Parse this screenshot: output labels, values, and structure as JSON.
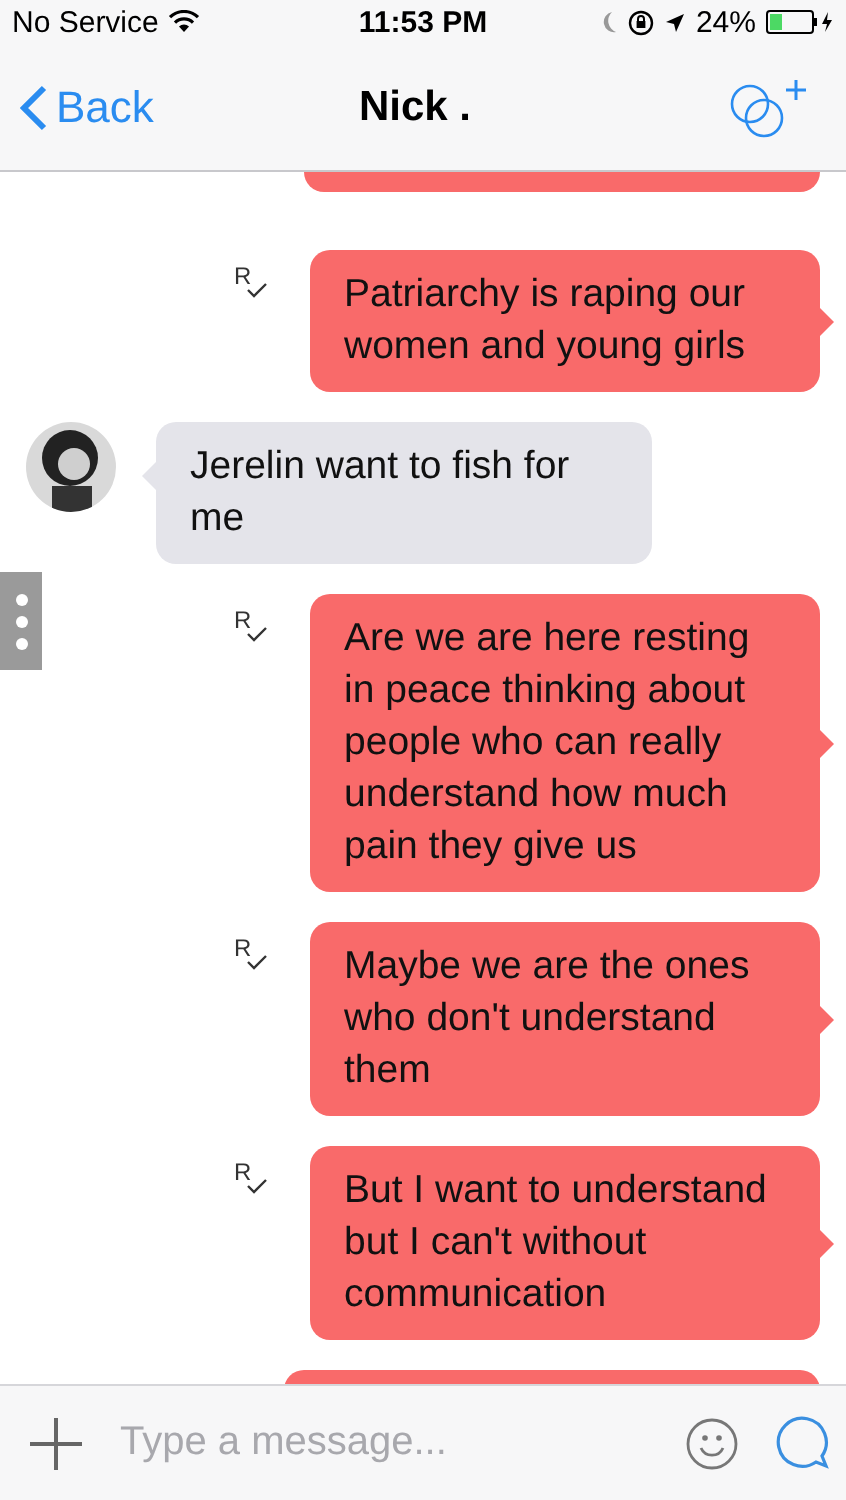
{
  "status_bar": {
    "carrier": "No Service",
    "time": "11:53 PM",
    "battery": "24%"
  },
  "nav_bar": {
    "back": "Back",
    "title": "Nick ."
  },
  "messages": [
    {
      "kind": "partial-top"
    },
    {
      "kind": "outgoing",
      "text": "Patriarchy is raping our women and young girls",
      "read_mark": "R"
    },
    {
      "kind": "incoming",
      "text": "Jerelin want to fish for me"
    },
    {
      "kind": "outgoing",
      "text": "Are we are here resting in peace thinking about people who can really understand how much pain they give us",
      "read_mark": "R"
    },
    {
      "kind": "outgoing",
      "text": "Maybe we are the ones who don't understand them",
      "read_mark": "R"
    },
    {
      "kind": "outgoing",
      "text": "But I want to understand but I can't without communication",
      "read_mark": "R"
    },
    {
      "kind": "partial-bottom"
    }
  ],
  "composer": {
    "placeholder": "Type a message..."
  }
}
